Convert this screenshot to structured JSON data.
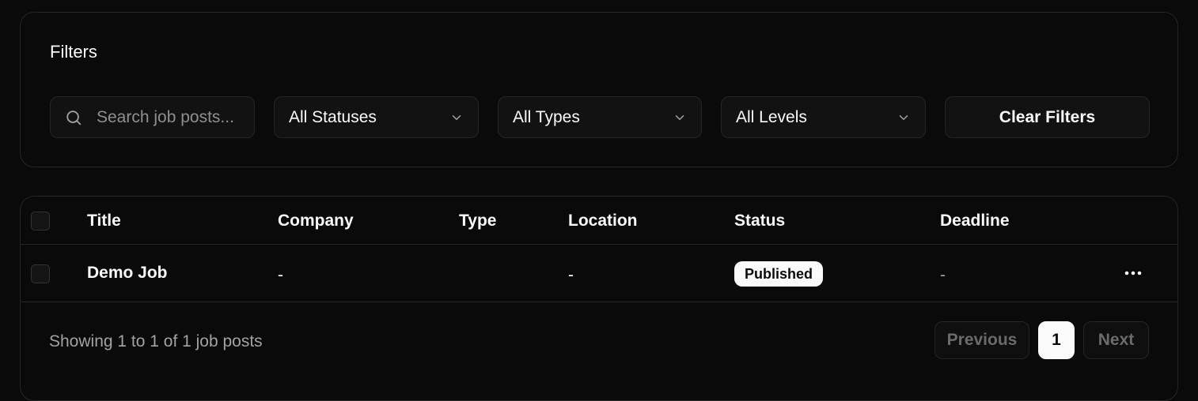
{
  "filters": {
    "title": "Filters",
    "search_placeholder": "Search job posts...",
    "search_value": "",
    "status_select": "All Statuses",
    "type_select": "All Types",
    "level_select": "All Levels",
    "clear_label": "Clear Filters"
  },
  "table": {
    "columns": [
      "Title",
      "Company",
      "Type",
      "Location",
      "Status",
      "Deadline"
    ],
    "rows": [
      {
        "title": "Demo Job",
        "company": "-",
        "type": "",
        "location": "-",
        "status": "Published",
        "deadline": "-"
      }
    ]
  },
  "footer": {
    "showing_text": "Showing 1 to 1 of 1 job posts",
    "previous_label": "Previous",
    "current_page": "1",
    "next_label": "Next"
  },
  "icons": {
    "search": "search-icon",
    "chevron": "chevron-down-icon",
    "more": "more-horizontal-icon"
  },
  "colors": {
    "background": "#0a0a0a",
    "border": "#262626",
    "badge_bg": "#fafafa",
    "muted_text": "#a3a3a3"
  }
}
